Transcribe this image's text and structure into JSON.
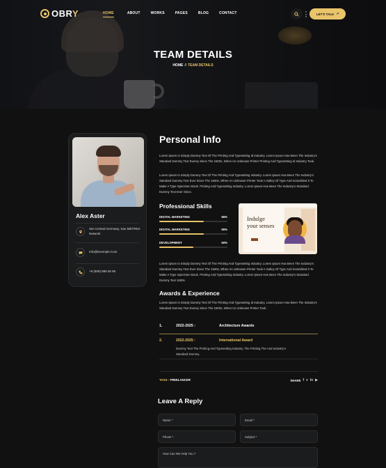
{
  "brand": {
    "name_prefix": "OBR",
    "name_suffix": "Y"
  },
  "nav": {
    "items": [
      "HOME",
      "ABOUT",
      "WORKS",
      "PAGES",
      "BLOG",
      "CONTACT"
    ],
    "active": "HOME",
    "cta_label": "LET'S TALK"
  },
  "hero": {
    "title": "TEAM DETAILS",
    "crumb_home": "HOME",
    "crumb_sep": "//",
    "crumb_current": "TEAM DETAILS"
  },
  "profile": {
    "name": "Alex Aster",
    "address": "45A Central Germany, San METREX Network",
    "email": "Info@Exemple.Com",
    "phone": "+9 (509) 885 56 86"
  },
  "personal": {
    "title": "Personal Info",
    "para1": "Lorem Ipsum Is Simply Dummy Text Of The Printing And Typesetting Id Industry. Lorem Ipsum Has Been The Industry's Standard Dummy Text Everey Since The 1500s, When An Unknown Printer Printing And Typesetting Id Industry Took.",
    "para2": "Lorem Ipsum Is Simply Dummy Text Of The Printing And Typesetting Industry. Lorem Ipsum Has Been The Industry's Standard Dummy Text Ever Since The 1500s, When An Unknown Printer Took A Galley Of Type And Scrambled It To Make A Type Specimen Book. Printing And Typesetting Industry. Lorem Ipsum Has Been The Industry's Standard Dummy Text Ever Since.",
    "para3": "Lorem Ipsum Is Simply Dummy Text Of The Printing And Typesetting Industry. Lorem Ipsum Has Been The Industry's Standard Dummy Text Ever Since The 1500s, When An Unknown Printer Took A Galley Of Type And Scrambled It To Make A Type Specimen Book. Printing And Typesetting Industry. Lorem Ipsum Has Been The Industry's Standard Dummy Text 1500s."
  },
  "skills": {
    "title": "Professional Skills",
    "items": [
      {
        "label": "DIGITAL MARKETING",
        "value": "65%",
        "level": 0.65
      },
      {
        "label": "DIGITAL MARKETING",
        "value": "65%",
        "level": 0.65
      },
      {
        "label": "DEVELOPMENT",
        "value": "50%",
        "level": 0.5
      }
    ]
  },
  "promo": {
    "headline_1": "Indulge",
    "headline_2": "your senses"
  },
  "awards": {
    "title": "Awards & Experience",
    "intro": "Lorem Ipsum Is Simply Dummy Text Of The Printing And Typesetting Id Industry. Lorem Ipsum Has Been The Industry's Standard Dummy Text Everey Since The 1500s, When An Unknown Printer Took.",
    "items": [
      {
        "num": "1.",
        "years": "2022-2025 :",
        "title": "Architecture Awards"
      },
      {
        "num": "2.",
        "years": "2022-2025 :",
        "title": "International  Award",
        "desc": "Dummy Text The Printing And Typesetting Industry. The Printing The And Industry's Standard Dummy."
      }
    ]
  },
  "tags": {
    "label": "TAGS :",
    "value": "FREELANCER"
  },
  "share": {
    "label": "SHARE"
  },
  "reply": {
    "title": "Leave A Reply",
    "name_placeholder": "Name *",
    "email_placeholder": "Email *",
    "phone_placeholder": "Phone *",
    "subject_placeholder": "Subject *",
    "message_placeholder": "How Can We Help You ?"
  },
  "colors": {
    "accent": "#e9c46a",
    "background": "#111111",
    "card": "#1b1c1d"
  }
}
